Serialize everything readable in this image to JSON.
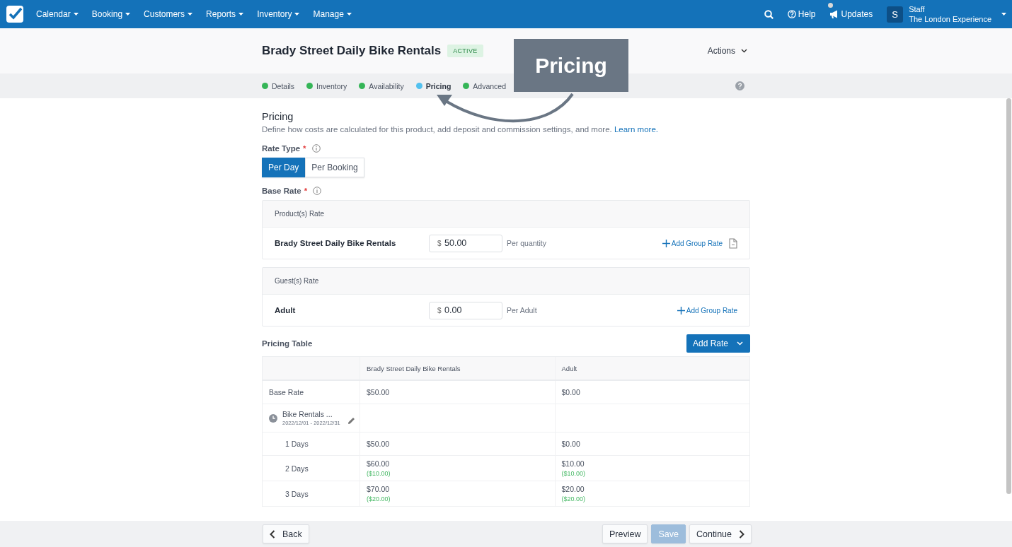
{
  "topbar": {
    "nav": [
      {
        "label": "Calendar"
      },
      {
        "label": "Booking"
      },
      {
        "label": "Customers"
      },
      {
        "label": "Reports"
      },
      {
        "label": "Inventory"
      },
      {
        "label": "Manage"
      }
    ],
    "help": "Help",
    "updates": "Updates",
    "user": {
      "initial": "S",
      "role": "Staff",
      "company": "The London Experience"
    }
  },
  "header": {
    "title": "Brady Street Daily Bike Rentals",
    "status": "ACTIVE",
    "actions": "Actions"
  },
  "steps": [
    {
      "label": "Details",
      "selected": false
    },
    {
      "label": "Inventory",
      "selected": false
    },
    {
      "label": "Availability",
      "selected": false
    },
    {
      "label": "Pricing",
      "selected": true
    },
    {
      "label": "Advanced",
      "selected": false
    }
  ],
  "callout": {
    "text": "Pricing"
  },
  "section": {
    "title": "Pricing",
    "description": "Define how costs are calculated for this product, add deposit and commission settings, and more.",
    "link": "Learn more."
  },
  "rate_type": {
    "label": "Rate Type",
    "required": true,
    "required_mark": "*",
    "options": [
      {
        "label": "Per Day",
        "selected": true
      },
      {
        "label": "Per Booking",
        "selected": false
      }
    ]
  },
  "base_rate": {
    "label": "Base Rate",
    "required": true,
    "required_mark": "*",
    "groups": [
      {
        "heading": "Product(s) Rate",
        "rows": [
          {
            "name": "Brady Street Daily Bike Rentals",
            "currency": "$",
            "value": "50.00",
            "unit": "Per quantity",
            "link": "Add Group Rate",
            "document": true
          }
        ]
      },
      {
        "heading": "Guest(s) Rate",
        "rows": [
          {
            "name": "Adult",
            "currency": "$",
            "value": "0.00",
            "unit": "Per Adult",
            "link": "Add Group Rate",
            "document": false
          }
        ]
      }
    ]
  },
  "pricing_table": {
    "title": "Pricing Table",
    "add_button": "Add Rate",
    "columns": [
      "Brady Street Daily Bike Rentals",
      "Adult"
    ],
    "rows": [
      {
        "kind": "base",
        "label": "Base Rate",
        "cells": [
          {
            "value": "$50.00"
          },
          {
            "value": "$0.00"
          }
        ]
      },
      {
        "kind": "season",
        "label": "Bike Rentals ...",
        "dates": "2022/12/01 - 2022/12/31"
      },
      {
        "kind": "tier",
        "label": "1 Days",
        "cells": [
          {
            "value": "$50.00"
          },
          {
            "value": "$0.00"
          }
        ]
      },
      {
        "kind": "tier",
        "label": "2 Days",
        "cells": [
          {
            "value": "$60.00",
            "change": "($10.00)"
          },
          {
            "value": "$10.00",
            "change": "($10.00)"
          }
        ]
      },
      {
        "kind": "tier",
        "label": "3 Days",
        "cells": [
          {
            "value": "$70.00",
            "change": "($20.00)"
          },
          {
            "value": "$20.00",
            "change": "($20.00)"
          }
        ]
      }
    ]
  },
  "footer": {
    "back": "Back",
    "preview": "Preview",
    "save": {
      "label": "Save",
      "disabled": true
    },
    "continue": "Continue"
  }
}
